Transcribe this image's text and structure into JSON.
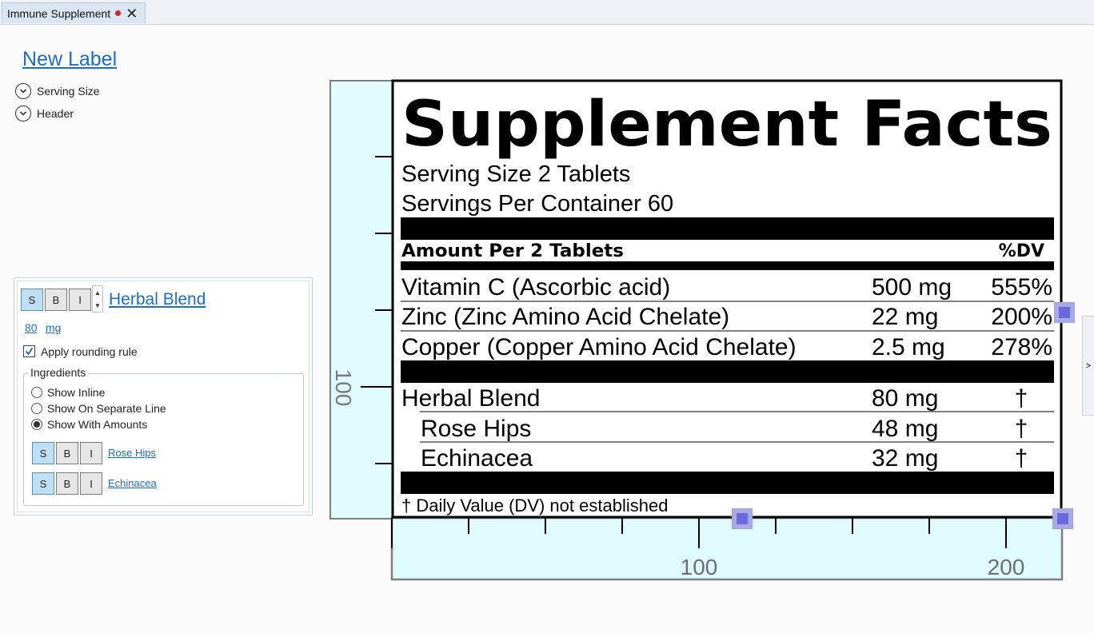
{
  "tab": {
    "title": "Immune Supplement",
    "close": "✕"
  },
  "left": {
    "new_label": "New Label",
    "sections": [
      {
        "label": "Serving Size"
      },
      {
        "label": "Header"
      }
    ]
  },
  "panel": {
    "format_buttons": [
      "S",
      "B",
      "I"
    ],
    "title": "Herbal Blend",
    "amount": "80",
    "unit": "mg",
    "rounding_label": "Apply rounding rule",
    "rounding_checked": true,
    "ingredients_title": "Ingredients",
    "radio_options": [
      {
        "label": "Show Inline",
        "selected": false
      },
      {
        "label": "Show On Separate Line",
        "selected": false
      },
      {
        "label": "Show With Amounts",
        "selected": true
      }
    ],
    "sub_ingredients": [
      {
        "name": "Rose Hips"
      },
      {
        "name": "Echinacea"
      }
    ]
  },
  "label": {
    "title": "Supplement Facts",
    "serving_size": "Serving Size 2 Tablets",
    "servings_per_container": "Servings Per Container 60",
    "amount_header": "Amount Per 2 Tablets",
    "dv_header": "%DV",
    "rows": [
      {
        "name": "Vitamin C (Ascorbic acid)",
        "amount": "500 mg",
        "dv": "555%"
      },
      {
        "name": "Zinc (Zinc Amino Acid Chelate)",
        "amount": "22 mg",
        "dv": "200%"
      },
      {
        "name": "Copper (Copper Amino Acid Chelate)",
        "amount": "2.5 mg",
        "dv": "278%"
      }
    ],
    "blend": {
      "name": "Herbal Blend",
      "amount": "80 mg",
      "dv": "†"
    },
    "blend_items": [
      {
        "name": "Rose Hips",
        "amount": "48 mg",
        "dv": "†"
      },
      {
        "name": "Echinacea",
        "amount": "32 mg",
        "dv": "†"
      }
    ],
    "footnote": "† Daily Value (DV) not established"
  },
  "rulers": {
    "horizontal_labels": [
      "100",
      "200"
    ],
    "vertical_label": "100"
  },
  "side_tab": ">"
}
